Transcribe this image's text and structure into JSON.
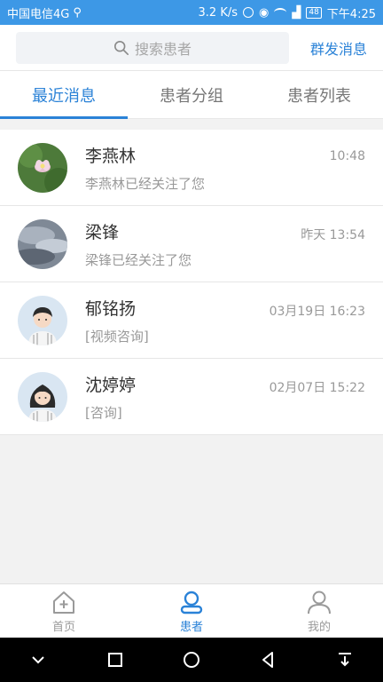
{
  "status_bar": {
    "carrier": "中国电信4G",
    "speed": "3.2 K/s",
    "battery": "48",
    "time": "下午4:25"
  },
  "header": {
    "search_placeholder": "搜索患者",
    "broadcast_label": "群发消息"
  },
  "tabs": [
    {
      "label": "最近消息",
      "active": true
    },
    {
      "label": "患者分组",
      "active": false
    },
    {
      "label": "患者列表",
      "active": false
    }
  ],
  "messages": [
    {
      "name": "李燕林",
      "preview": "李燕林已经关注了您",
      "time": "10:48",
      "avatar": "lotus-photo"
    },
    {
      "name": "梁锋",
      "preview": "梁锋已经关注了您",
      "time": "昨天   13:54",
      "avatar": "sky-photo"
    },
    {
      "name": "郁铭扬",
      "preview": "[视频咨询]",
      "time": "03月19日 16:23",
      "avatar": "male-avatar"
    },
    {
      "name": "沈婷婷",
      "preview": "[咨询]",
      "time": "02月07日 15:22",
      "avatar": "female-avatar"
    }
  ],
  "bottom_nav": [
    {
      "label": "首页",
      "icon": "home-icon",
      "active": false
    },
    {
      "label": "患者",
      "icon": "patient-icon",
      "active": true
    },
    {
      "label": "我的",
      "icon": "user-icon",
      "active": false
    }
  ],
  "colors": {
    "accent": "#2a82d7",
    "status_bar": "#3d98e6"
  }
}
